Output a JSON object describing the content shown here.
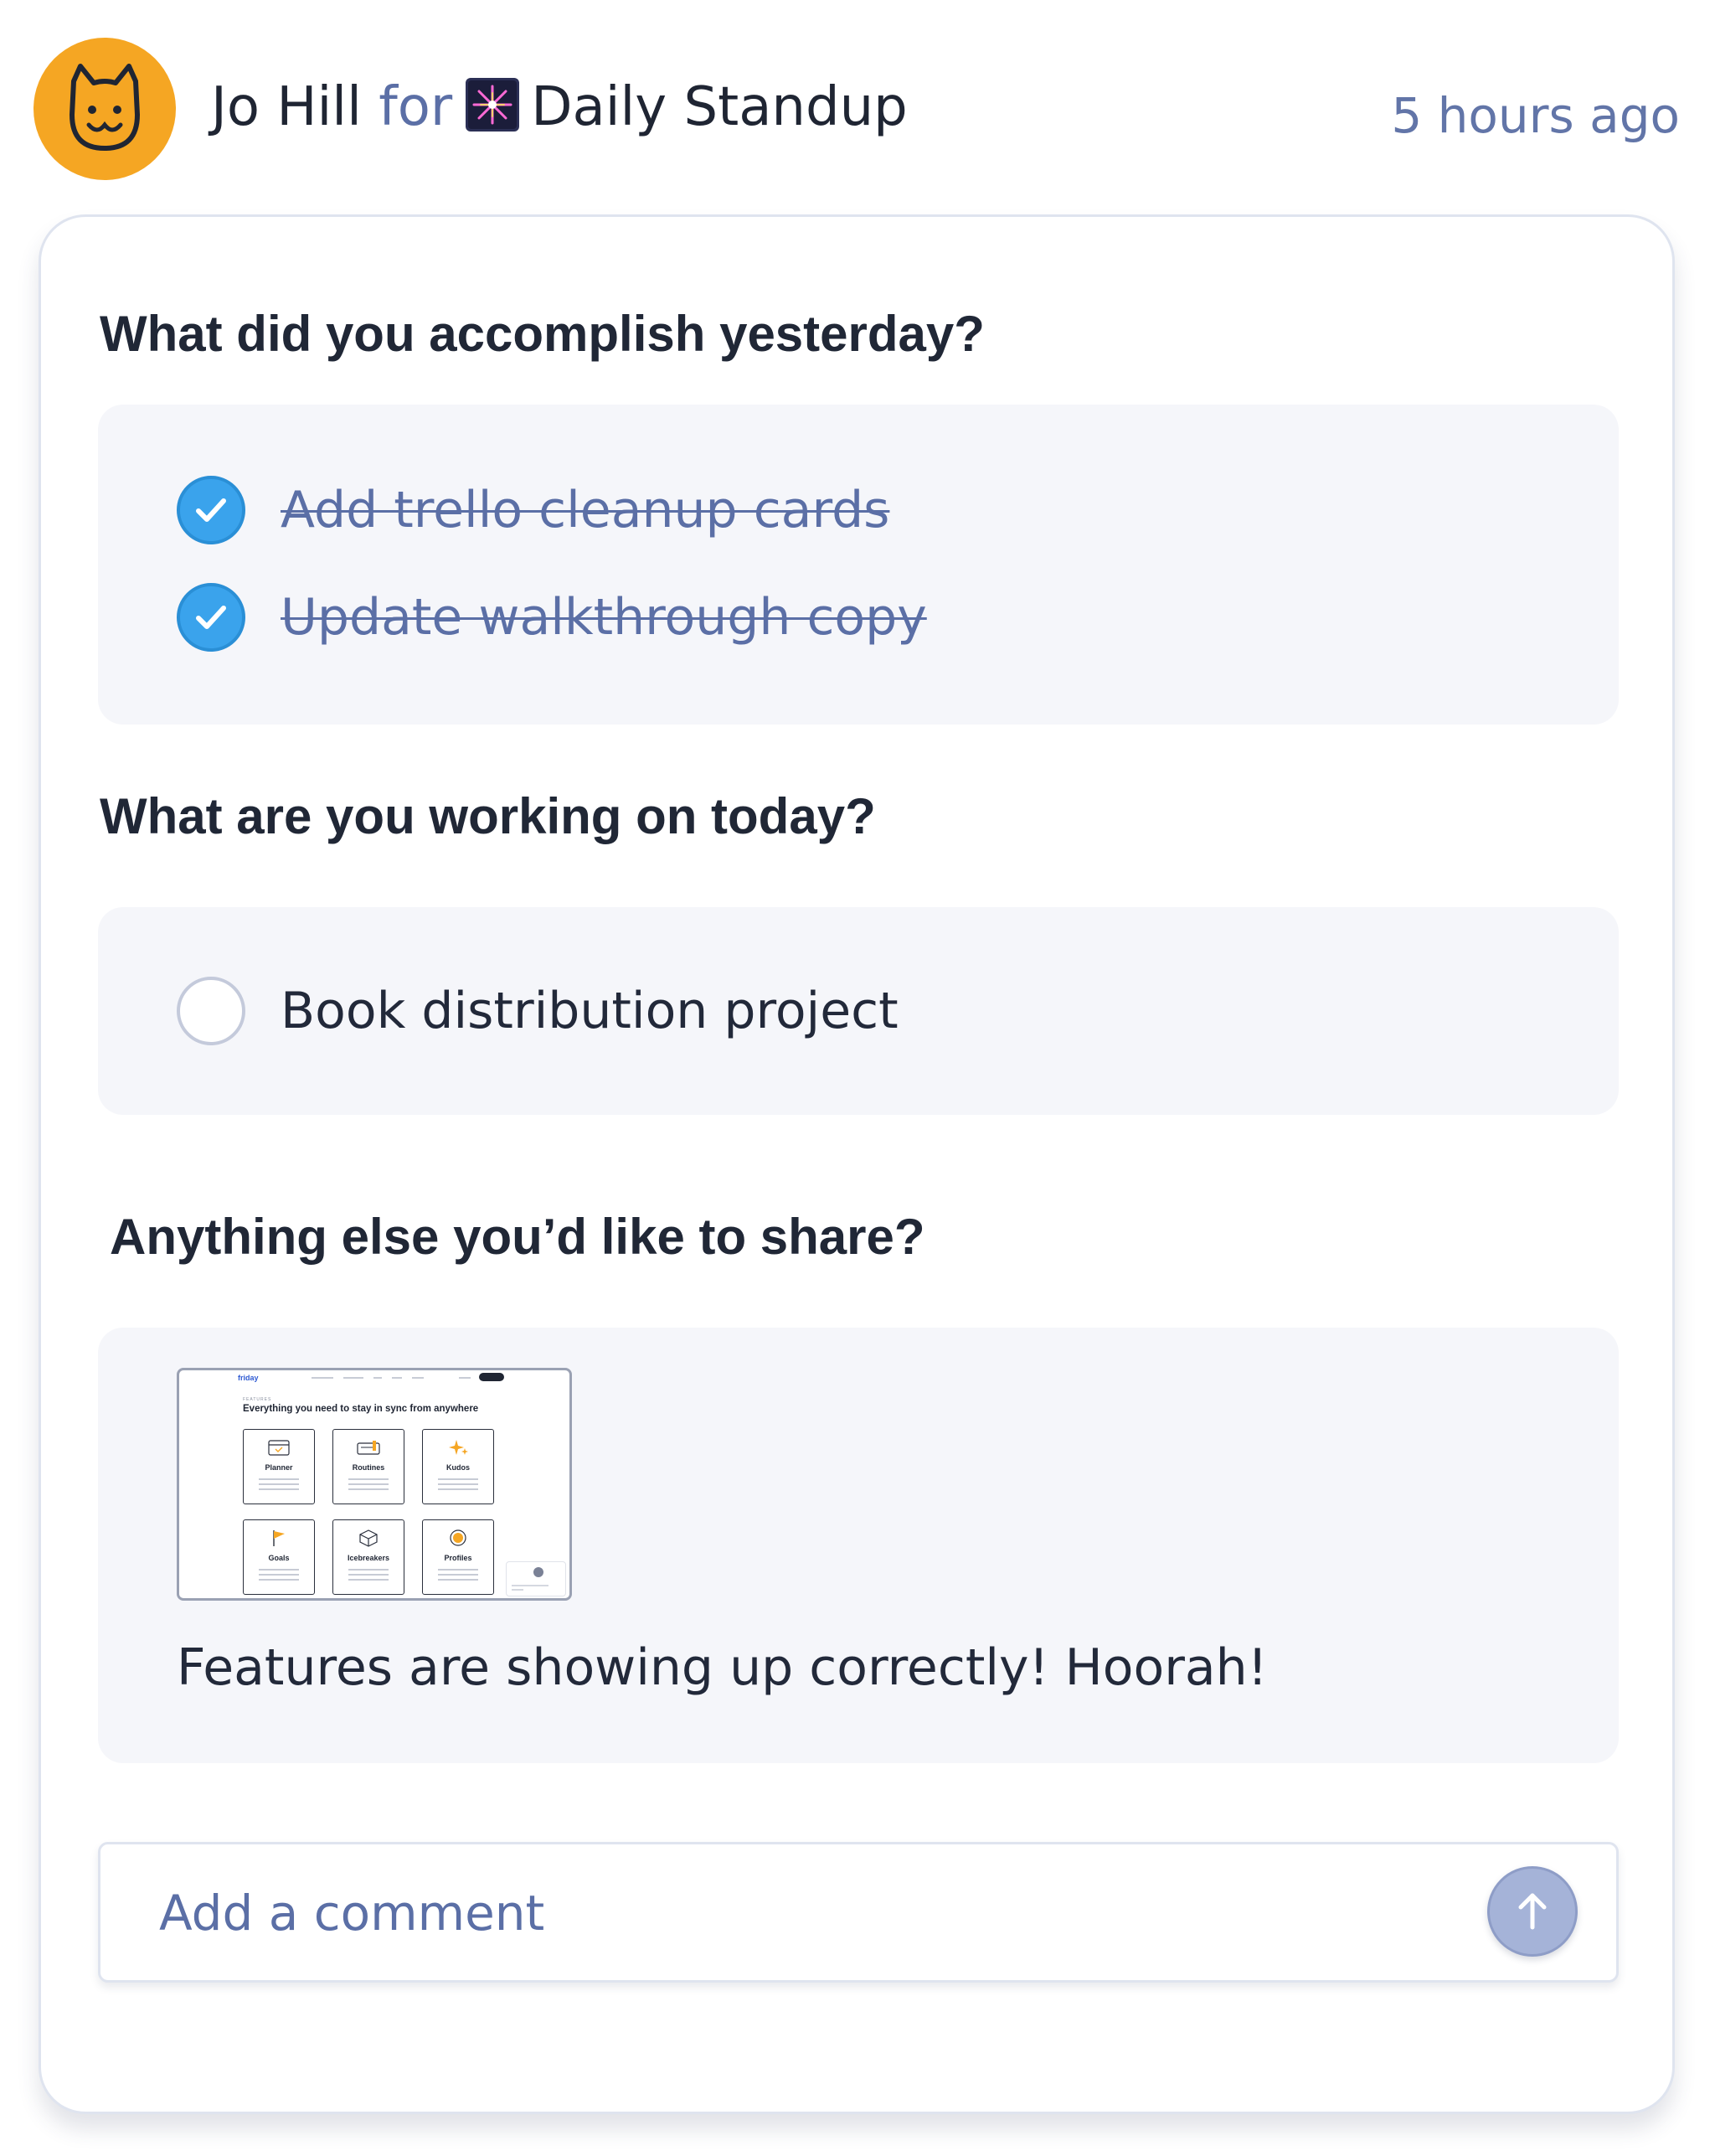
{
  "header": {
    "author": "Jo Hill",
    "connector": "for",
    "routine_icon": "fireworks-icon",
    "routine_name": "Daily Standup",
    "timestamp": "5 hours ago",
    "avatar_icon": "cat-face-icon",
    "avatar_color": "#f5a623"
  },
  "sections": [
    {
      "question": "What did you accomplish yesterday?",
      "items": [
        {
          "label": "Add trello cleanup cards",
          "completed": true
        },
        {
          "label": "Update walkthrough copy",
          "completed": true
        }
      ]
    },
    {
      "question": "What are you working on today?",
      "items": [
        {
          "label": "Book distribution project",
          "completed": false
        }
      ]
    },
    {
      "question": "Anything else you’d like to share?",
      "attachment": {
        "logo": "friday",
        "kicker": "FEATURES",
        "heading": "Everything you need to stay in sync from anywhere",
        "tiles": [
          "Planner",
          "Routines",
          "Kudos",
          "Goals",
          "Icebreakers",
          "Profiles"
        ]
      },
      "text": "Features are showing up correctly! Hoorah!"
    }
  ],
  "comment": {
    "placeholder": "Add a comment",
    "send_icon": "arrow-up-icon"
  },
  "colors": {
    "accent_blue": "#3aa3ec",
    "muted_text": "#5b6fa6",
    "panel_bg": "#f5f6fa"
  }
}
